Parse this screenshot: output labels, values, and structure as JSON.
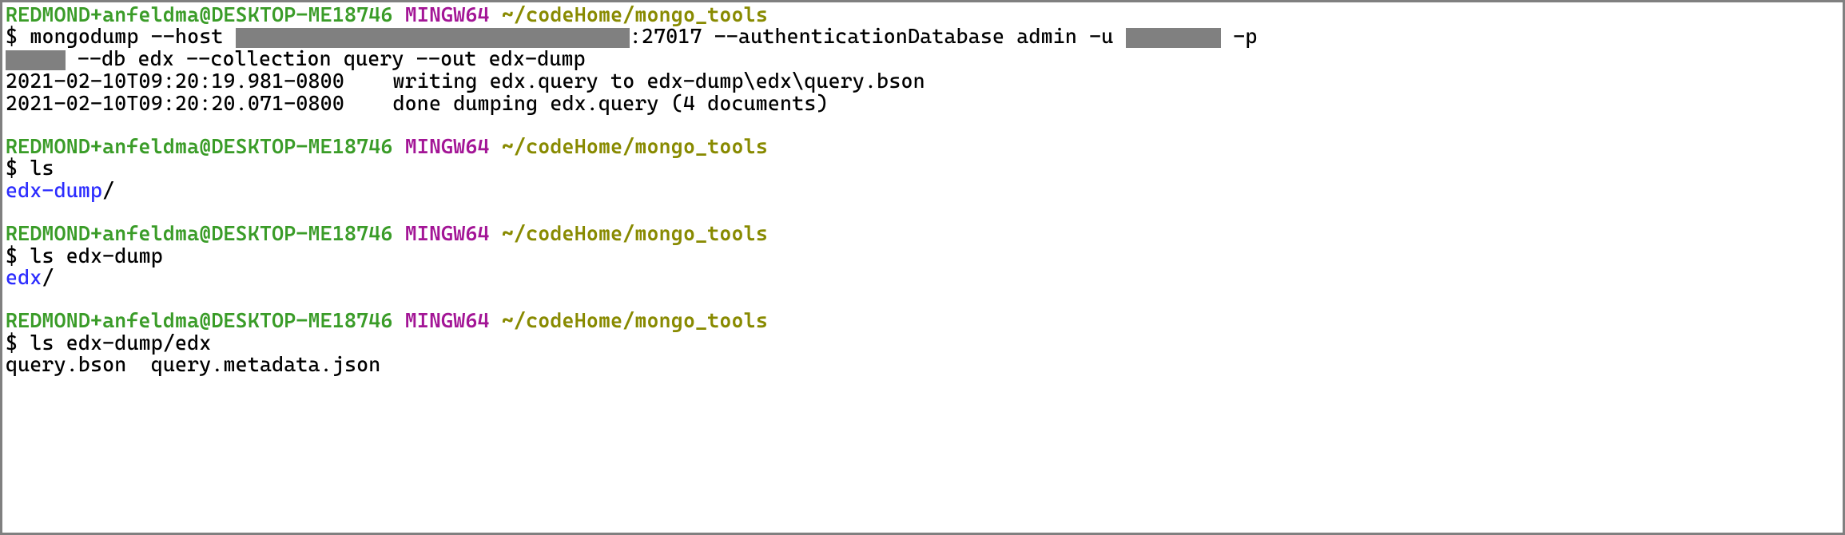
{
  "colors": {
    "border": "#808080",
    "green": "#3a9c28",
    "purple": "#a31596",
    "olive": "#888a00",
    "blue": "#2c2cff",
    "redact": "#808080"
  },
  "prompt": {
    "user_host": "REDMOND+anfeldma@DESKTOP-ME18746",
    "shell": "MINGW64",
    "cwd": "~/codeHome/mongo_tools",
    "symbol": "$"
  },
  "block1": {
    "cmd_pre_host": "mongodump --host ",
    "cmd_post_host": ":27017 --authenticationDatabase admin -u ",
    "cmd_post_user": " -p ",
    "cmd_line2": " --db edx --collection query --out edx-dump",
    "out1": "2021-02-10T09:20:19.981-0800    writing edx.query to edx-dump\\edx\\query.bson",
    "out2": "2021-02-10T09:20:20.071-0800    done dumping edx.query (4 documents)"
  },
  "block2": {
    "cmd": "ls",
    "out_dir": "edx-dump",
    "out_slash": "/"
  },
  "block3": {
    "cmd": "ls edx-dump",
    "out_dir": "edx",
    "out_slash": "/"
  },
  "block4": {
    "cmd": "ls edx-dump/edx",
    "out": "query.bson  query.metadata.json"
  }
}
